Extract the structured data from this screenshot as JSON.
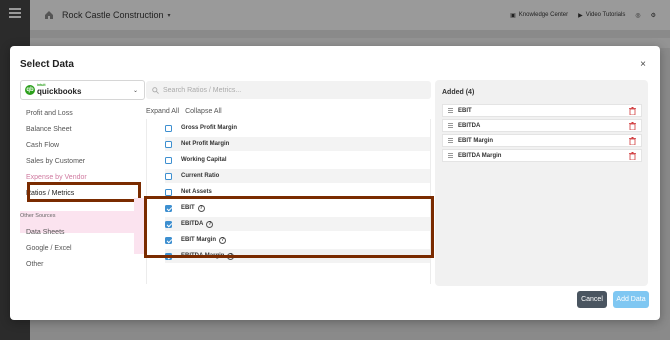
{
  "app": {
    "company_name": "Rock Castle Construction",
    "knowledge_center": "Knowledge Center",
    "video_tutorials": "Video Tutorials"
  },
  "modal": {
    "title": "Select Data",
    "close": "×"
  },
  "source_select": {
    "brand_small": "intuit",
    "brand": "quickbooks"
  },
  "left_nav": {
    "items": [
      "Profit and Loss",
      "Balance Sheet",
      "Cash Flow",
      "Sales by Customer",
      "Expense by Vendor",
      "Ratios / Metrics"
    ],
    "other_sources_label": "Other Sources",
    "other_items": [
      "Data Sheets",
      "Google / Excel",
      "Other"
    ]
  },
  "middle": {
    "search_placeholder": "Search Ratios / Metrics...",
    "expand_all": "Expand All",
    "collapse_all": "Collapse All",
    "metrics": [
      {
        "label": "Gross Profit Margin",
        "checked": false
      },
      {
        "label": "Net Profit Margin",
        "checked": false
      },
      {
        "label": "Working Capital",
        "checked": false
      },
      {
        "label": "Current Ratio",
        "checked": false
      },
      {
        "label": "Net Assets",
        "checked": false
      },
      {
        "label": "EBIT",
        "checked": true
      },
      {
        "label": "EBITDA",
        "checked": true
      },
      {
        "label": "EBIT Margin",
        "checked": true
      },
      {
        "label": "EBITDA Margin",
        "checked": true
      }
    ]
  },
  "added": {
    "title": "Added (4)",
    "items": [
      "EBIT",
      "EBITDA",
      "EBIT Margin",
      "EBITDA Margin"
    ]
  },
  "buttons": {
    "cancel": "Cancel",
    "add": "Add Data"
  },
  "colors": {
    "accent_blue": "#3d8fd0",
    "highlight_box": "#7a2b00",
    "brand_green": "#2ca01c",
    "trash_red": "#d0393b"
  }
}
